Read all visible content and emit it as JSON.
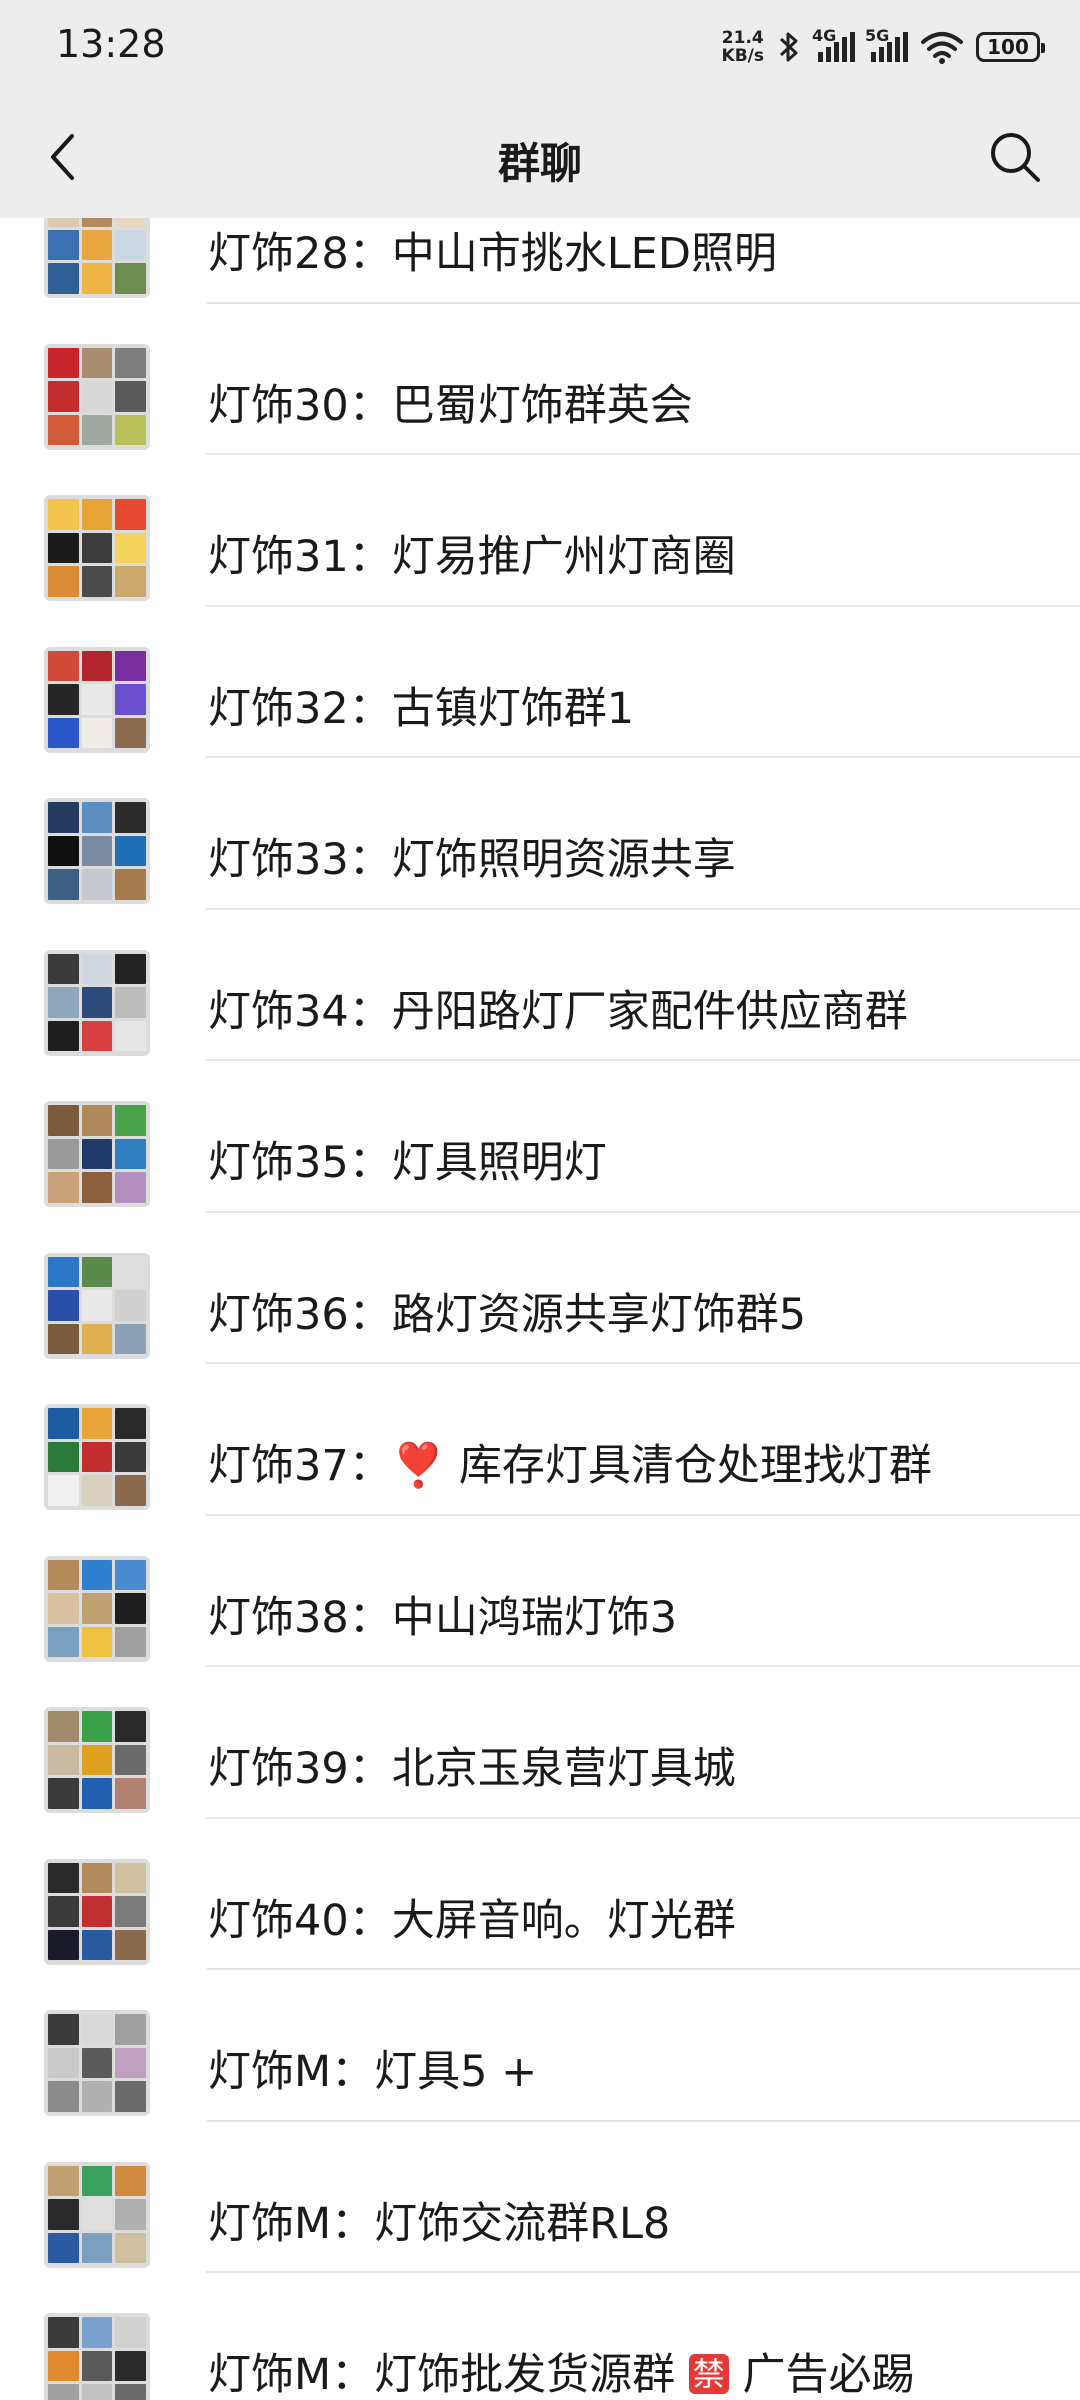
{
  "status_bar": {
    "time": "13:28",
    "net_speed_value": "21.4",
    "net_speed_unit": "KB/s",
    "signal_1_type": "4G",
    "signal_2_type": "5G",
    "battery": "100"
  },
  "header": {
    "title": "群聊"
  },
  "groups": [
    {
      "label": "灯饰28：中山市挑水LED照明",
      "colors": [
        "#d9c9b5",
        "#b58a5a",
        "#e8d7c0",
        "#3a6fb0",
        "#e9a640",
        "#c9d7e5",
        "#2f5f95",
        "#f0b544",
        "#6d8c4f"
      ]
    },
    {
      "label": "灯饰30：巴蜀灯饰群英会",
      "colors": [
        "#c6252c",
        "#a88d6e",
        "#7d7d7d",
        "#c22e2e",
        "#d8d8d8",
        "#5a5a5a",
        "#d05c3a",
        "#9fa9a0",
        "#b9c25a"
      ]
    },
    {
      "label": "灯饰31：灯易推广州灯商圈",
      "colors": [
        "#f2c44b",
        "#e8a337",
        "#e64a2e",
        "#1b1b1b",
        "#3c3c3c",
        "#f2d25a",
        "#d98b36",
        "#4a4a4a",
        "#caa76a"
      ]
    },
    {
      "label": "灯饰32：古镇灯饰群1",
      "colors": [
        "#d34a3a",
        "#b3262d",
        "#7a2fa0",
        "#262626",
        "#e9e9e9",
        "#6a4fcf",
        "#2a56c8",
        "#f1ece6",
        "#8d6b4d"
      ]
    },
    {
      "label": "灯饰33：灯饰照明资源共享",
      "colors": [
        "#243a5e",
        "#5b8fc2",
        "#2c2c2c",
        "#101010",
        "#7a8aa0",
        "#1e6fb5",
        "#3d5f86",
        "#c5c9cf",
        "#a57a4c"
      ]
    },
    {
      "label": "灯饰34：丹阳路灯厂家配件供应商群",
      "colors": [
        "#3a3a3a",
        "#cfd6dd",
        "#222222",
        "#8ea7bd",
        "#2c4a7a",
        "#bcbcbc",
        "#1e1e1e",
        "#d64040",
        "#e6e6e6"
      ]
    },
    {
      "label": "灯饰35：灯具照明灯",
      "colors": [
        "#7b5a3c",
        "#b0875a",
        "#47a24a",
        "#9a9a9a",
        "#1f3a6b",
        "#2f7fc0",
        "#c9a27a",
        "#8b5e3c",
        "#b58fc0"
      ]
    },
    {
      "label": "灯饰36：路灯资源共享灯饰群5",
      "colors": [
        "#2b76c5",
        "#5a8a4a",
        "#dcdcdc",
        "#2a4fa8",
        "#e8e8e8",
        "#cfcfcf",
        "#7a5a3a",
        "#e0b050",
        "#8aa0b5"
      ]
    },
    {
      "label": "灯饰37：❣️ 库存灯具清仓处理找灯群",
      "colors": [
        "#1f5aa0",
        "#e8a33a",
        "#2a2a2a",
        "#2c7a3a",
        "#c22e2e",
        "#3a3a3a",
        "#f0f0f0",
        "#d9d0c0",
        "#8a6a4a"
      ]
    },
    {
      "label": "灯饰38：中山鸿瑞灯饰3",
      "colors": [
        "#b58a5a",
        "#2f7fd0",
        "#4a8ad0",
        "#d9c0a0",
        "#c0a070",
        "#1e1e1e",
        "#7aa0c0",
        "#f0c040",
        "#a0a0a0"
      ]
    },
    {
      "label": "灯饰39：北京玉泉营灯具城",
      "colors": [
        "#a08a6a",
        "#3aa04a",
        "#2a2a2a",
        "#c9b9a0",
        "#e0a020",
        "#6a6a6a",
        "#3a3a3a",
        "#2060b0",
        "#b08070"
      ]
    },
    {
      "label": "灯饰40：大屏音响。灯光群",
      "colors": [
        "#2a2a2a",
        "#b08a5a",
        "#d0c0a0",
        "#3a3a3a",
        "#c03030",
        "#7a7a7a",
        "#1a1a2a",
        "#2a5aa0",
        "#8a6a4a"
      ]
    },
    {
      "label": "灯饰M：灯具5 +",
      "colors": [
        "#3a3a3a",
        "#d9d9d9",
        "#a0a0a0",
        "#c9c9c9",
        "#5a5a5a",
        "#c0a0c0",
        "#8a8a8a",
        "#b0b0b0",
        "#6a6a6a"
      ]
    },
    {
      "label": "灯饰M：灯饰交流群RL8",
      "colors": [
        "#c0a070",
        "#3aa060",
        "#d08a40",
        "#2a2a2a",
        "#e0e0e0",
        "#b0b0b0",
        "#2a5aa0",
        "#7aa0c0",
        "#d0c0a0"
      ]
    },
    {
      "label": "灯饰M：灯饰批发货源群",
      "badge": "禁",
      "label_tail": "广告必踢",
      "colors": [
        "#3a3a3a",
        "#7aa0d0",
        "#d0d0d0",
        "#e08a30",
        "#5a5a5a",
        "#2a2a2a",
        "#a0a0a0",
        "#c0c0c0",
        "#6a6a6a"
      ]
    }
  ]
}
